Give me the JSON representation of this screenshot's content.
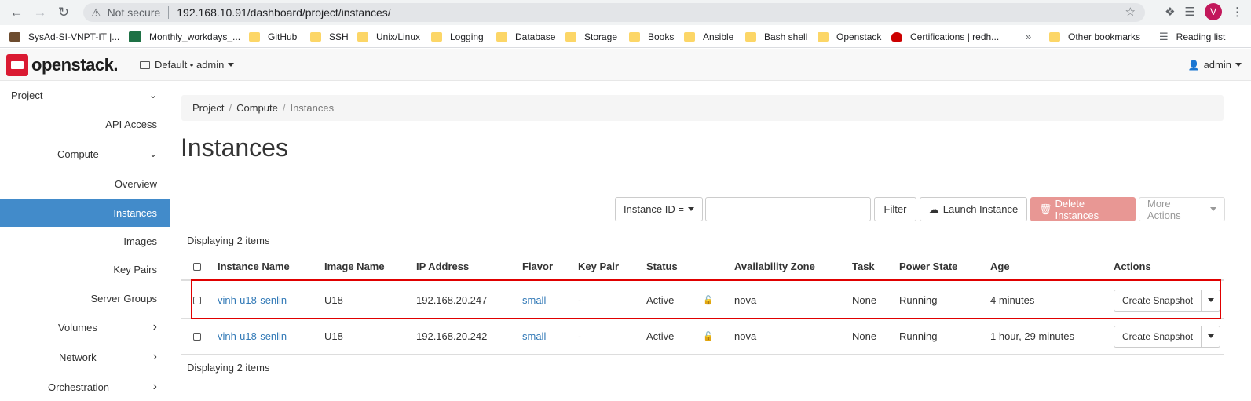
{
  "browser": {
    "security_label": "Not secure",
    "url": "192.168.10.91/dashboard/project/instances/",
    "profile_initial": "V",
    "bookmarks": [
      {
        "label": "SysAd-SI-VNPT-IT |...",
        "icon": "trello-icon"
      },
      {
        "label": "Monthly_workdays_...",
        "icon": "excel-icon"
      },
      {
        "label": "GitHub",
        "icon": "folder-icon"
      },
      {
        "label": "SSH",
        "icon": "folder-icon"
      },
      {
        "label": "Unix/Linux",
        "icon": "folder-icon"
      },
      {
        "label": "Logging",
        "icon": "folder-icon"
      },
      {
        "label": "Database",
        "icon": "folder-icon"
      },
      {
        "label": "Storage",
        "icon": "folder-icon"
      },
      {
        "label": "Books",
        "icon": "folder-icon"
      },
      {
        "label": "Ansible",
        "icon": "folder-icon"
      },
      {
        "label": "Bash shell",
        "icon": "folder-icon"
      },
      {
        "label": "Openstack",
        "icon": "folder-icon"
      },
      {
        "label": "Certifications | redh...",
        "icon": "redhat-icon"
      }
    ],
    "overflow": "»",
    "other_bookmarks": "Other bookmarks",
    "reading_list": "Reading list"
  },
  "topbar": {
    "logo_text": "openstack.",
    "project_selector": "Default • admin",
    "user": "admin"
  },
  "sidebar": {
    "project": "Project",
    "api_access": "API Access",
    "compute": "Compute",
    "overview": "Overview",
    "instances": "Instances",
    "images": "Images",
    "key_pairs": "Key Pairs",
    "server_groups": "Server Groups",
    "volumes": "Volumes",
    "network": "Network",
    "orchestration": "Orchestration"
  },
  "breadcrumb": [
    "Project",
    "Compute",
    "Instances"
  ],
  "page_title": "Instances",
  "toolbar": {
    "filter_field": "Instance ID =",
    "filter_value": "",
    "filter_button": "Filter",
    "launch_button": "Launch Instance",
    "delete_button": "Delete Instances",
    "more_button": "More Actions"
  },
  "displaying": "Displaying 2 items",
  "table": {
    "headers": [
      "Instance Name",
      "Image Name",
      "IP Address",
      "Flavor",
      "Key Pair",
      "Status",
      "Availability Zone",
      "Task",
      "Power State",
      "Age",
      "Actions"
    ],
    "rows": [
      {
        "name": "vinh-u18-senlin",
        "image": "U18",
        "ip": "192.168.20.247",
        "flavor": "small",
        "keypair": "-",
        "status": "Active",
        "az": "nova",
        "task": "None",
        "power": "Running",
        "age": "4 minutes",
        "action": "Create Snapshot"
      },
      {
        "name": "vinh-u18-senlin",
        "image": "U18",
        "ip": "192.168.20.242",
        "flavor": "small",
        "keypair": "-",
        "status": "Active",
        "az": "nova",
        "task": "None",
        "power": "Running",
        "age": "1 hour, 29 minutes",
        "action": "Create Snapshot"
      }
    ]
  },
  "colors": {
    "accent": "#428bca",
    "danger": "#e89794",
    "highlight": "#e00000",
    "link": "#337ab7"
  }
}
